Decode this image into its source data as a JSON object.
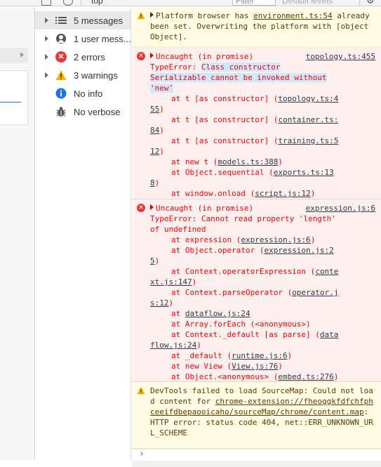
{
  "toolbar": {
    "context": "top",
    "filter_placeholder": "Filter",
    "levels_label": "Default levels",
    "settings_icon": "gear-icon"
  },
  "sidebar": {
    "items": [
      {
        "label": "5 messages",
        "icon": "list-icon",
        "expandable": true,
        "selected": true
      },
      {
        "label": "1 user mess...",
        "icon": "user-icon",
        "expandable": true
      },
      {
        "label": "2 errors",
        "icon": "error-icon",
        "expandable": true
      },
      {
        "label": "3 warnings",
        "icon": "warning-icon",
        "expandable": true
      },
      {
        "label": "No info",
        "icon": "info-icon",
        "expandable": false
      },
      {
        "label": "No verbose",
        "icon": "bug-icon",
        "expandable": false
      }
    ]
  },
  "console": {
    "messages": [
      {
        "level": "warning",
        "text_a": "Platform browser has ",
        "source": "environment.ts:54",
        "text_b": "already been set. Overwriting the platform with [object Object]."
      },
      {
        "level": "error",
        "header": "Uncaught (in promise)",
        "source": "topology.ts:455",
        "error_line_1": "TypeError: ",
        "error_hl_1": "Class constructor",
        "error_hl_2": "Serializable cannot be invoked without",
        "error_hl_3": "'new'",
        "frames": [
          {
            "text": "at t [as constructor] (",
            "link_a": "topology.ts:4",
            "link_b": "55",
            "close": ")"
          },
          {
            "text": "at t [as constructor] (",
            "link_a": "container.ts:",
            "link_b": "84",
            "close": ")"
          },
          {
            "text": "at t [as constructor] (",
            "link_a": "training.ts:5",
            "link_b": "12",
            "close": ")"
          },
          {
            "text": "at new t (",
            "link_a": "models.ts:388",
            "link_b": "",
            "close": ")"
          },
          {
            "text": "at Object.sequential (",
            "link_a": "exports.ts:13",
            "link_b": "8",
            "close": ")"
          },
          {
            "text": "at window.onload (",
            "link_a": "script.js:12",
            "link_b": "",
            "close": ")"
          }
        ]
      },
      {
        "level": "error",
        "header": "Uncaught (in promise)",
        "source": "expression.js:6",
        "error_line_1": "TypeError: Cannot read property 'length'",
        "error_line_2": "of undefined",
        "frames": [
          {
            "text": "at expression (",
            "link_a": "expression.js:6",
            "link_b": "",
            "close": ")"
          },
          {
            "text": "at Object.operator (",
            "link_a": "expression.js:2",
            "link_b": "5",
            "close": ")"
          },
          {
            "text": "at Context.operatorExpression (",
            "link_a": "conte",
            "link_b": "xt.js:147",
            "close": ")"
          },
          {
            "text": "at Context.parseOperator (",
            "link_a": "operator.j",
            "link_b": "s:12",
            "close": ")"
          },
          {
            "text": "at ",
            "link_a": "dataflow.js:24",
            "link_b": "",
            "close": ""
          },
          {
            "text": "at Array.forEach (<anonymous>)",
            "link_a": "",
            "link_b": "",
            "close": ""
          },
          {
            "text": "at Context._default [as parse] (",
            "link_a": "data",
            "link_b": "flow.js:24",
            "close": ")"
          },
          {
            "text": "at _default (",
            "link_a": "runtime.js:6",
            "link_b": "",
            "close": ")"
          },
          {
            "text": "at new View (",
            "link_a": "View.js:76",
            "link_b": "",
            "close": ")"
          },
          {
            "text": "at Object.<anonymous> (",
            "link_a": "embed.ts:276",
            "link_b": "",
            "close": ")"
          }
        ]
      },
      {
        "level": "warning",
        "text_a": "DevTools failed to load SourceMap: Could not load content for ",
        "source": "chrome-extension://fheoggkfdfchfphceeifdbepaooicaho/sourceMap/chrome/content.map",
        "text_b": ": HTTP error: status code 404, net::ERR_UNKNOWN_URL_SCHEME"
      }
    ],
    "prompt": "›"
  }
}
